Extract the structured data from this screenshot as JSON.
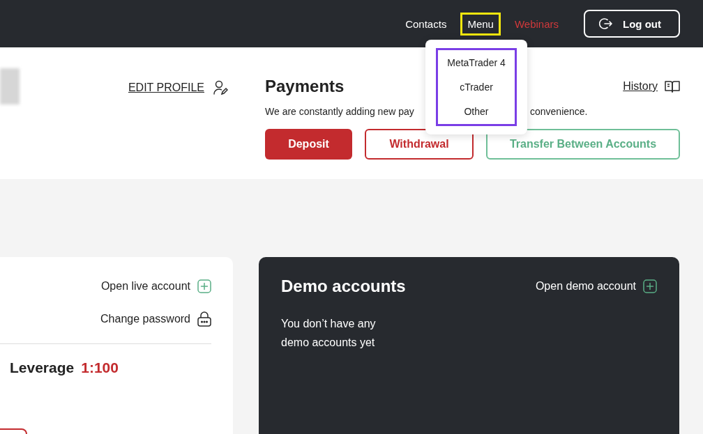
{
  "nav": {
    "links": [
      {
        "label": "Contacts",
        "kind": "plain",
        "highlighted": false
      },
      {
        "label": "Menu",
        "kind": "plain",
        "highlighted": true
      },
      {
        "label": "Webinars",
        "kind": "accent",
        "highlighted": false
      }
    ],
    "logout": "Log out"
  },
  "menu_dropdown": {
    "items": [
      "MetaTrader 4",
      "cTrader",
      "Other"
    ]
  },
  "profile": {
    "edit_profile": "EDIT PROFILE"
  },
  "payments": {
    "title": "Payments",
    "history": "History",
    "note_start": "We are constantly adding new pay",
    "note_end": "convenience.",
    "buttons": [
      {
        "label": "Deposit",
        "kind": "filled"
      },
      {
        "label": "Withdrawal",
        "kind": "outline-red"
      },
      {
        "label": "Transfer Between Accounts",
        "kind": "outline-green"
      }
    ]
  },
  "live_card": {
    "actions": [
      {
        "label": "Open live account",
        "kind": "add"
      },
      {
        "label": "Change password",
        "kind": "lock"
      }
    ],
    "leverage_label": "Leverage",
    "leverage_value": "1:100"
  },
  "demo_card": {
    "title": "Demo accounts",
    "action": "Open demo account",
    "empty_text": "You don’t have any demo accounts yet"
  }
}
